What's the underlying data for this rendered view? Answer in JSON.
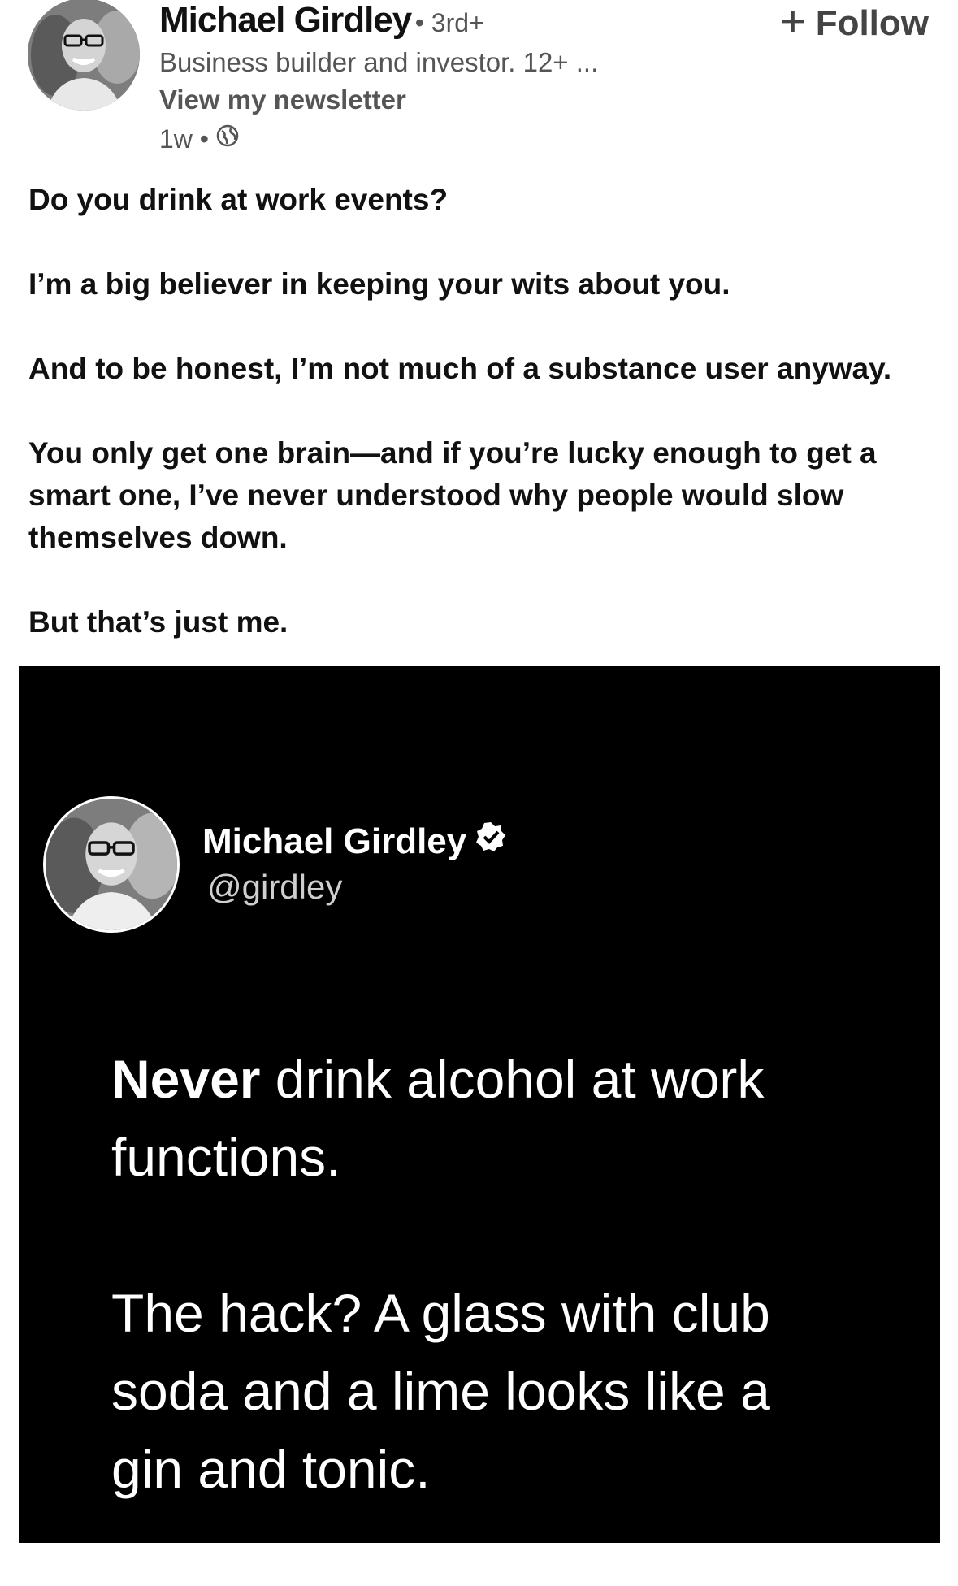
{
  "post": {
    "author": "Michael Girdley",
    "degree": "• 3rd+",
    "headline": "Business builder and investor. 12+ ...",
    "newsletter_link": "View my newsletter",
    "time": "1w •",
    "follow_label": "Follow",
    "paragraphs": [
      "Do you drink at work events?",
      "I’m a big believer in keeping your wits about you.",
      "And to be honest, I’m not much of a substance user anyway.",
      "You only get one brain—and if you’re lucky enough to get a smart one, I’ve never understood why people would slow themselves down.",
      "But that’s just me."
    ]
  },
  "embed": {
    "name": "Michael Girdley",
    "handle": "@girdley",
    "tweet_bold": "Never",
    "tweet_line1_rest": " drink alcohol at work functions.",
    "tweet_line2": "The hack? A glass with club soda and a lime looks like a gin and tonic."
  },
  "icons": {
    "follow": "plus-icon",
    "visibility": "globe-icon",
    "verified": "verified-badge-icon"
  },
  "colors": {
    "background": "#ffffff",
    "embed_background": "#000000",
    "muted_text": "#555555"
  }
}
